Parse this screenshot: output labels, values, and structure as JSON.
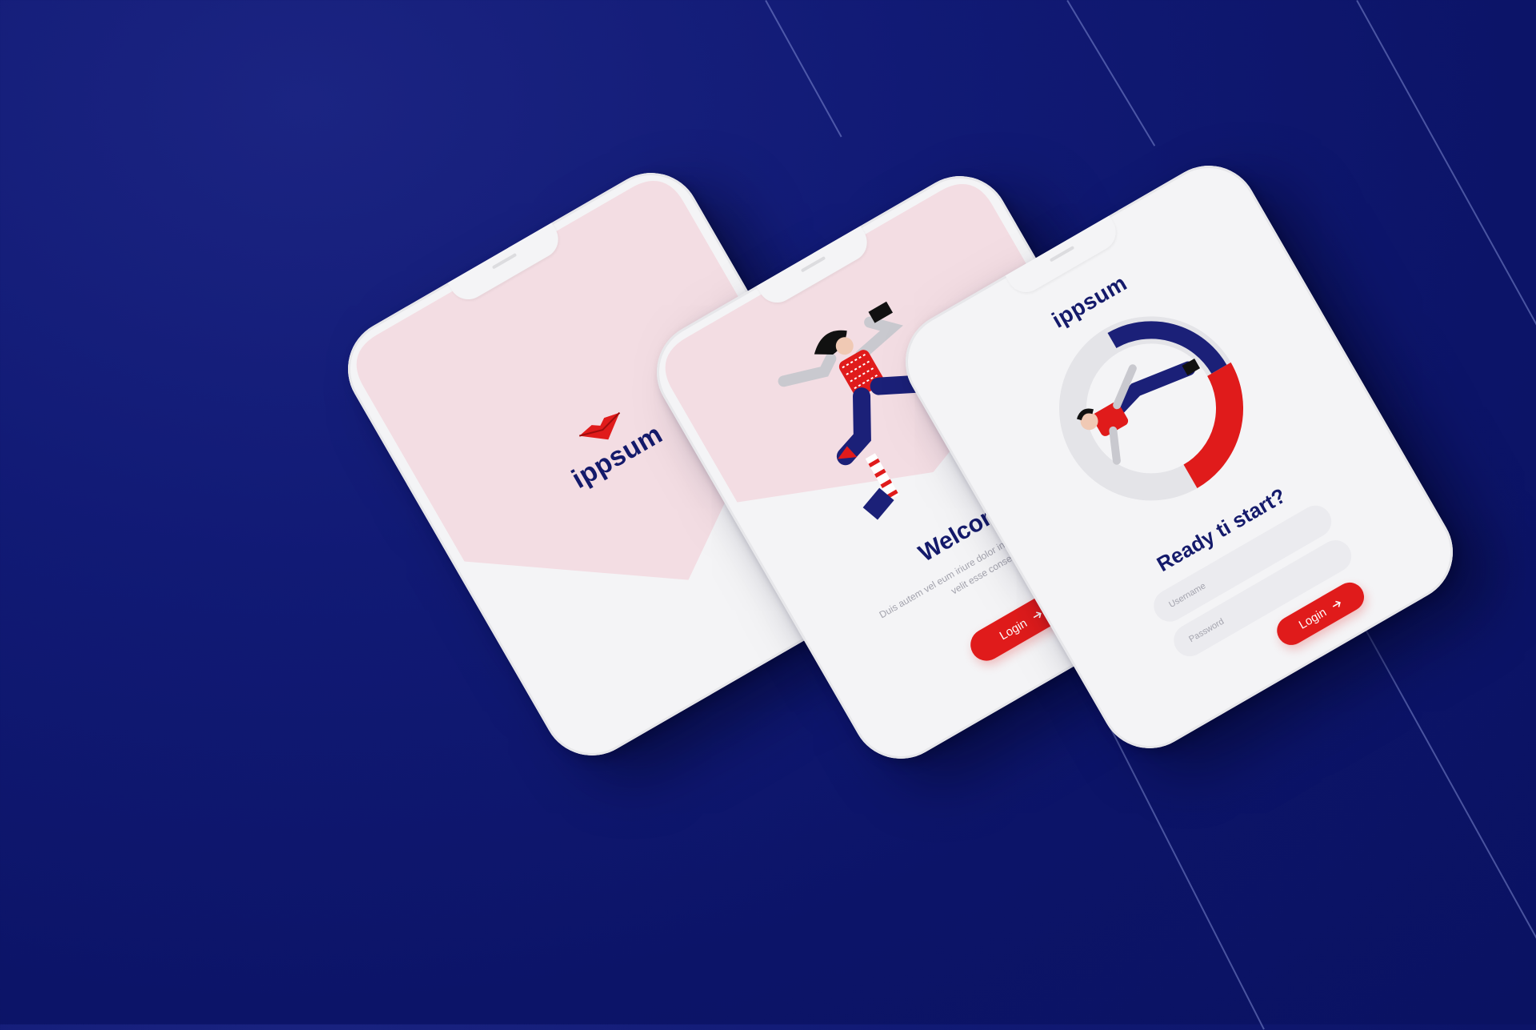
{
  "colors": {
    "brand_navy": "#141a6b",
    "accent_red": "#e01b1b",
    "pink": "#f3dde3",
    "background": "#0c1468"
  },
  "icons": [
    "logo-lips-icon",
    "arrow-right-icon"
  ],
  "phone1": {
    "brand": "ippsum"
  },
  "phone2": {
    "title": "Welcome",
    "body": "Duis autem vel eum iriure dolor in hendrerit in vulputate velit esse consequat",
    "login_label": "Login"
  },
  "phone3": {
    "brand": "ippsum",
    "title": "Ready ti start?",
    "username_placeholder": "Username",
    "password_placeholder": "Password",
    "login_label": "Login"
  }
}
